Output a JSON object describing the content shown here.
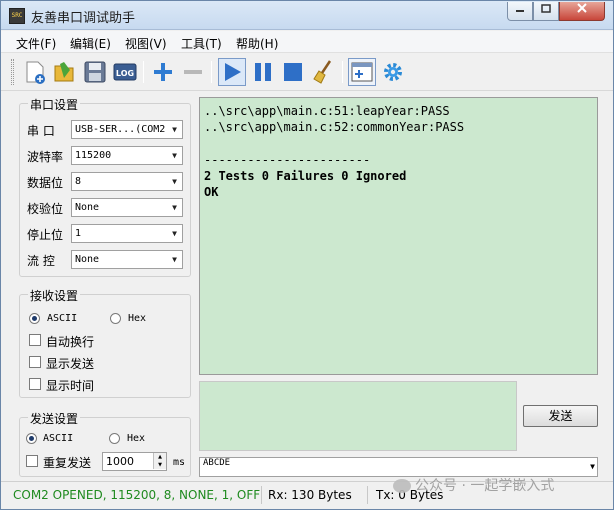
{
  "window": {
    "title": "友善串口调试助手",
    "app_icon_text": "SRC"
  },
  "menu": [
    {
      "label": "文件(F)"
    },
    {
      "label": "编辑(E)"
    },
    {
      "label": "视图(V)"
    },
    {
      "label": "工具(T)"
    },
    {
      "label": "帮助(H)"
    }
  ],
  "toolbar": {
    "log_label": "LOG",
    "icons": [
      "new-file-icon",
      "open-folder-icon",
      "save-icon",
      "log-icon",
      "add-icon",
      "remove-icon",
      "play-icon",
      "pause-icon",
      "stop-icon",
      "broom-clear-icon",
      "window-add-icon",
      "gear-icon"
    ]
  },
  "serial": {
    "group_title": "串口设置",
    "port_label": "串  口",
    "port_value": "USB-SER...(COM2",
    "baud_label": "波特率",
    "baud_value": "115200",
    "data_label": "数据位",
    "data_value": "8",
    "parity_label": "校验位",
    "parity_value": "None",
    "stop_label": "停止位",
    "stop_value": "1",
    "flow_label": "流  控",
    "flow_value": "None"
  },
  "receive": {
    "group_title": "接收设置",
    "ascii": "ASCII",
    "hex": "Hex",
    "auto_wrap": "自动换行",
    "show_send": "显示发送",
    "show_time": "显示时间",
    "lines": [
      "..\\src\\app\\main.c:51:leapYear:PASS",
      "..\\src\\app\\main.c:52:commonYear:PASS",
      "",
      "-----------------------",
      "2 Tests 0 Failures 0 Ignored",
      "OK"
    ]
  },
  "send": {
    "group_title": "发送设置",
    "ascii": "ASCII",
    "hex": "Hex",
    "repeat": "重复发送",
    "interval": "1000",
    "unit": "ms",
    "button": "发送",
    "input_value": "ABCDE"
  },
  "status": {
    "port": "COM2 OPENED, 115200, 8, NONE, 1, OFF",
    "rx": "Rx: 130 Bytes",
    "tx": "Tx: 0 Bytes",
    "port_color": "#1f8a1f"
  },
  "watermark": "公众号 · 一起学嵌入式"
}
